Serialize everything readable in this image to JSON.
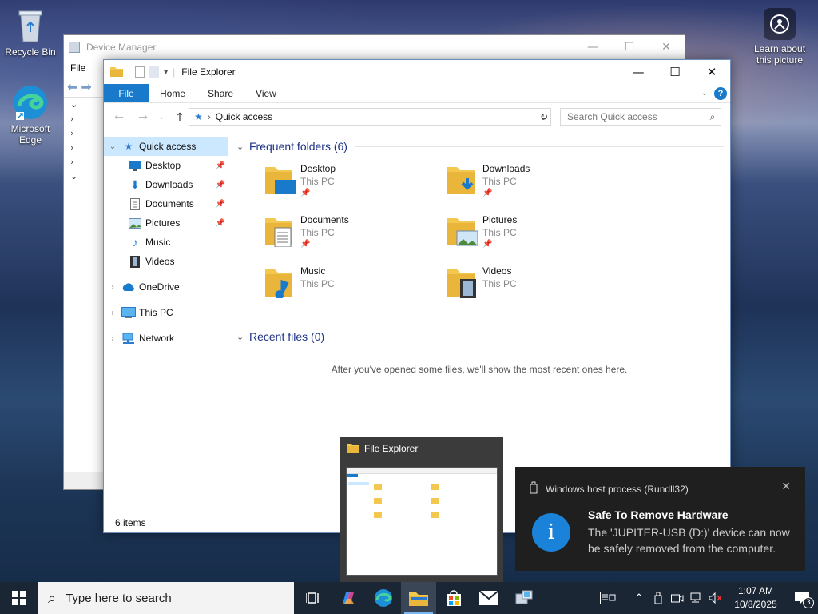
{
  "desktop": {
    "icons": [
      {
        "label": "Recycle Bin"
      },
      {
        "label": "Microsoft Edge"
      }
    ],
    "learn_label": "Learn about this picture"
  },
  "device_manager": {
    "title": "Device Manager",
    "menu_file": "File"
  },
  "file_explorer": {
    "title": "File Explorer",
    "ribbon_tabs": [
      "File",
      "Home",
      "Share",
      "View"
    ],
    "address": "Quick access",
    "search_placeholder": "Search Quick access",
    "nav": {
      "quick_access": "Quick access",
      "pinned": [
        "Desktop",
        "Downloads",
        "Documents",
        "Pictures",
        "Music",
        "Videos"
      ],
      "onedrive": "OneDrive",
      "this_pc": "This PC",
      "network": "Network"
    },
    "frequent_header": "Frequent folders (6)",
    "folders": [
      {
        "name": "Desktop",
        "loc": "This PC",
        "pinned": true
      },
      {
        "name": "Downloads",
        "loc": "This PC",
        "pinned": true
      },
      {
        "name": "Documents",
        "loc": "This PC",
        "pinned": true
      },
      {
        "name": "Pictures",
        "loc": "This PC",
        "pinned": true
      },
      {
        "name": "Music",
        "loc": "This PC",
        "pinned": false
      },
      {
        "name": "Videos",
        "loc": "This PC",
        "pinned": false
      }
    ],
    "recent_header": "Recent files (0)",
    "recent_empty": "After you've opened some files, we'll show the most recent ones here.",
    "status": "6 items"
  },
  "thumbnail": {
    "title": "File Explorer"
  },
  "toast": {
    "source": "Windows host process (Rundll32)",
    "heading": "Safe To Remove Hardware",
    "body": "The 'JUPITER-USB (D:)' device can now be safely removed from the computer."
  },
  "taskbar": {
    "search_placeholder": "Type here to search",
    "time": "1:07 AM",
    "date": "10/8/2025",
    "notification_count": "3"
  },
  "colors": {
    "accent": "#1979ca",
    "taskbar": "#1b2634",
    "toast_bg": "#1f1f1f",
    "info_blue": "#1a82d9"
  }
}
